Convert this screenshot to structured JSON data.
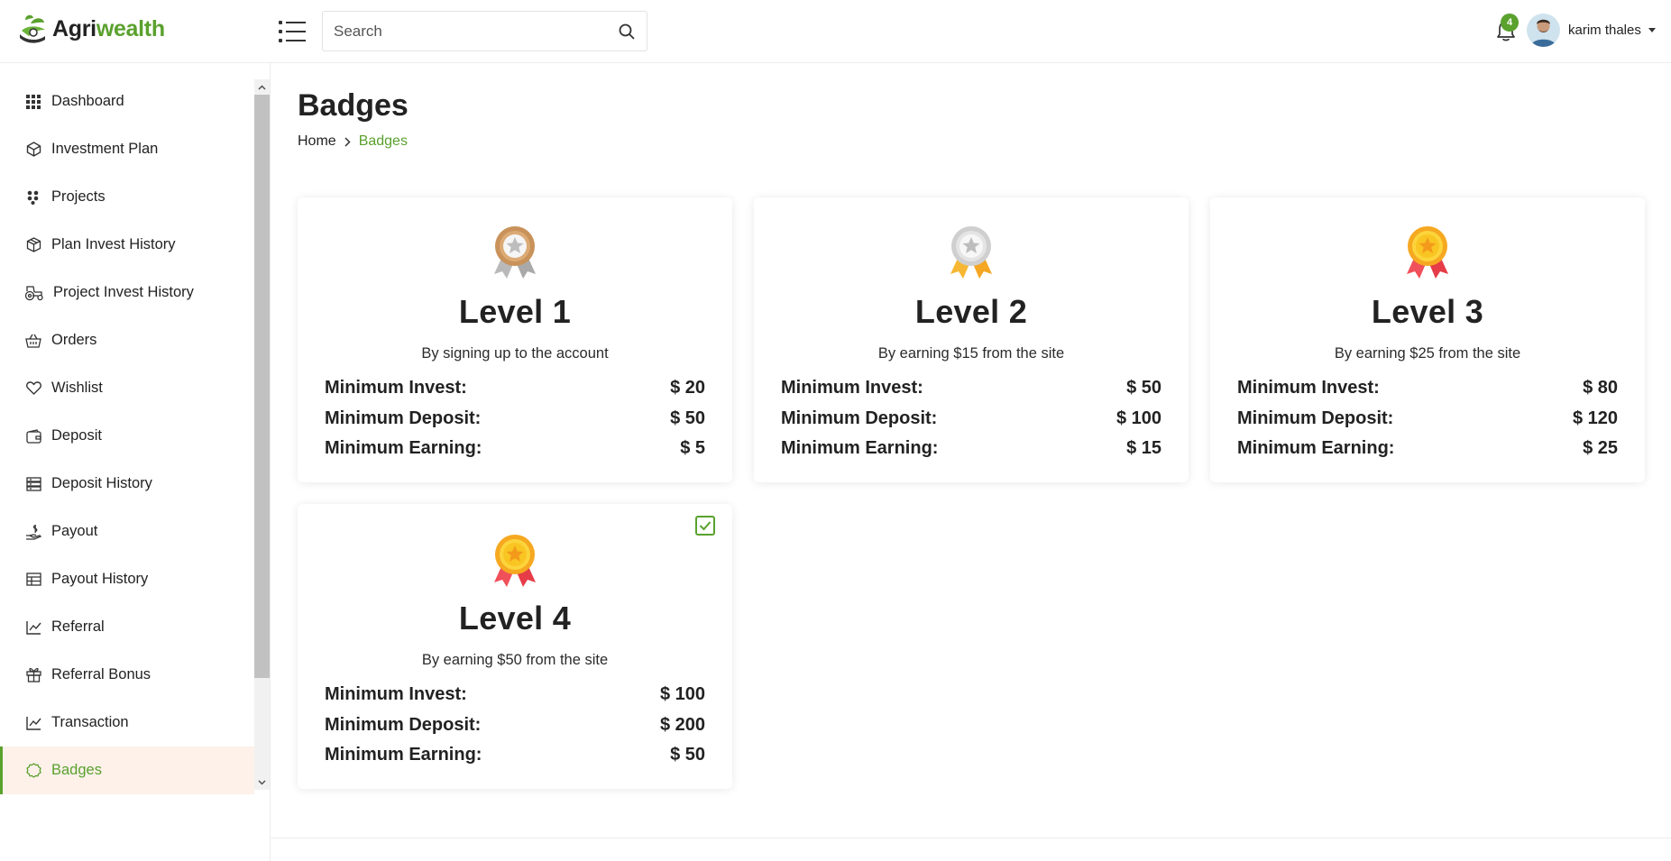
{
  "brand": {
    "name_part1": "Agri",
    "name_part2": "wealth",
    "accent": "#5aa12e"
  },
  "search": {
    "placeholder": "Search"
  },
  "notifications": {
    "count": "4"
  },
  "user": {
    "name": "karim thales"
  },
  "sidebar": {
    "items": [
      {
        "label": "Dashboard",
        "icon": "grid-icon"
      },
      {
        "label": "Investment Plan",
        "icon": "cube-network-icon"
      },
      {
        "label": "Projects",
        "icon": "dots-cluster-icon"
      },
      {
        "label": "Plan Invest History",
        "icon": "box-icon"
      },
      {
        "label": "Project Invest History",
        "icon": "tractor-icon"
      },
      {
        "label": "Orders",
        "icon": "basket-icon"
      },
      {
        "label": "Wishlist",
        "icon": "heart-icon"
      },
      {
        "label": "Deposit",
        "icon": "wallet-icon"
      },
      {
        "label": "Deposit History",
        "icon": "list-icon"
      },
      {
        "label": "Payout",
        "icon": "hand-coin-icon"
      },
      {
        "label": "Payout History",
        "icon": "table-icon"
      },
      {
        "label": "Referral",
        "icon": "line-chart-icon"
      },
      {
        "label": "Referral Bonus",
        "icon": "gift-icon"
      },
      {
        "label": "Transaction",
        "icon": "line-chart-icon"
      },
      {
        "label": "Badges",
        "icon": "badge-icon",
        "active": true
      }
    ]
  },
  "page": {
    "title": "Badges",
    "breadcrumb": {
      "home": "Home",
      "current": "Badges"
    }
  },
  "badges": [
    {
      "level": "Level 1",
      "description": "By signing up to the account",
      "min_invest_label": "Minimum Invest:",
      "min_invest": "$ 20",
      "min_deposit_label": "Minimum Deposit:",
      "min_deposit": "$ 50",
      "min_earning_label": "Minimum Earning:",
      "min_earning": "$ 5",
      "medal": "bronze-medal-icon",
      "achieved": false
    },
    {
      "level": "Level 2",
      "description": "By earning $15 from the site",
      "min_invest_label": "Minimum Invest:",
      "min_invest": "$ 50",
      "min_deposit_label": "Minimum Deposit:",
      "min_deposit": "$ 100",
      "min_earning_label": "Minimum Earning:",
      "min_earning": "$ 15",
      "medal": "silver-medal-icon",
      "achieved": false
    },
    {
      "level": "Level 3",
      "description": "By earning $25 from the site",
      "min_invest_label": "Minimum Invest:",
      "min_invest": "$ 80",
      "min_deposit_label": "Minimum Deposit:",
      "min_deposit": "$ 120",
      "min_earning_label": "Minimum Earning:",
      "min_earning": "$ 25",
      "medal": "gold-medal-icon",
      "achieved": false
    },
    {
      "level": "Level 4",
      "description": "By earning $50 from the site",
      "min_invest_label": "Minimum Invest:",
      "min_invest": "$ 100",
      "min_deposit_label": "Minimum Deposit:",
      "min_deposit": "$ 200",
      "min_earning_label": "Minimum Earning:",
      "min_earning": "$ 50",
      "medal": "gold-medal-icon",
      "achieved": true
    }
  ]
}
